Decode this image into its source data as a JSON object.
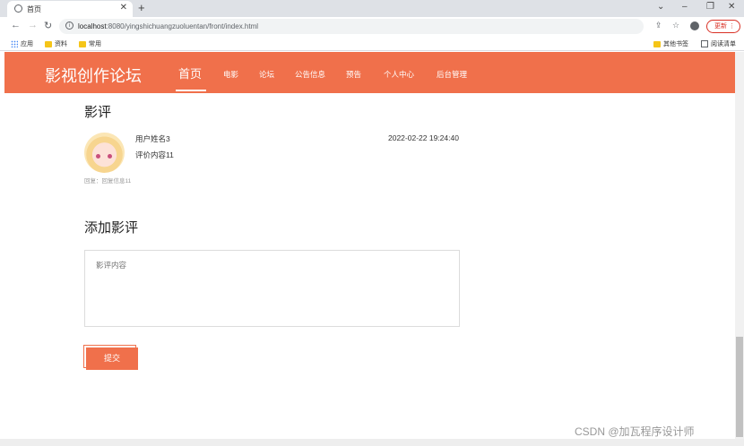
{
  "browser": {
    "tab_title": "首页",
    "new_tab": "+",
    "url_host": "localhost",
    "url_rest": ":8080/yingshichuangzuoluentan/front/index.html",
    "update_label": "更新 ⋮",
    "bookmarks": [
      "应用",
      "资料",
      "常用"
    ],
    "other_bookmarks": "其他书签",
    "reading_list": "阅读清单"
  },
  "site": {
    "logo": "影视创作论坛",
    "menu": [
      "首页",
      "电影",
      "论坛",
      "公告信息",
      "预告",
      "个人中心",
      "后台管理"
    ]
  },
  "reviews": {
    "title": "影评",
    "items": [
      {
        "username": "用户姓名3",
        "content": "评价内容11",
        "time": "2022-02-22 19:24:40",
        "reply": "回复：回复信息11"
      }
    ]
  },
  "add_review": {
    "title": "添加影评",
    "placeholder": "影评内容",
    "submit_label": "提交"
  },
  "watermark": "CSDN @加瓦程序设计师"
}
